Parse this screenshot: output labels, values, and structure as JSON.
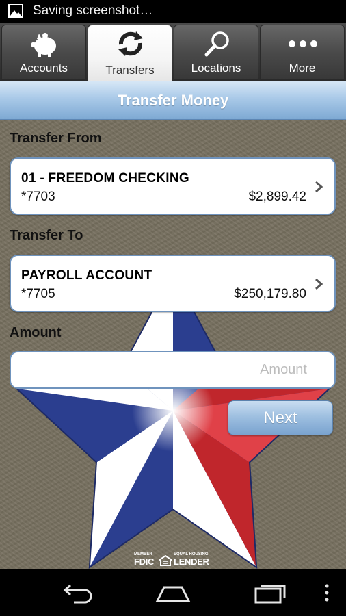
{
  "status_bar": {
    "notification_text": "Saving screenshot…",
    "icons": [
      "image-icon"
    ]
  },
  "tabs": [
    {
      "label": "Accounts",
      "icon": "piggy-bank-icon",
      "active": false
    },
    {
      "label": "Transfers",
      "icon": "transfer-arrows-icon",
      "active": true
    },
    {
      "label": "Locations",
      "icon": "magnifier-icon",
      "active": false
    },
    {
      "label": "More",
      "icon": "more-dots-icon",
      "active": false
    }
  ],
  "header": {
    "title": "Transfer Money"
  },
  "transfer_from": {
    "label": "Transfer From",
    "account": {
      "name": "01 - FREEDOM CHECKING",
      "number": "*7703",
      "balance": "$2,899.42"
    }
  },
  "transfer_to": {
    "label": "Transfer To",
    "account": {
      "name": "PAYROLL ACCOUNT",
      "number": "*7705",
      "balance": "$250,179.80"
    }
  },
  "amount": {
    "label": "Amount",
    "value": "",
    "placeholder": "Amount"
  },
  "next_button": {
    "label": "Next"
  },
  "footer": {
    "member_text": "MEMBER",
    "fdic_text": "FDIC",
    "equal_housing_text": "EQUAL HOUSING",
    "lender_text": "LENDER"
  },
  "colors": {
    "accent_blue": "#7ea9d3",
    "card_border": "#6f93bd",
    "star_red": "#c0262c",
    "star_blue": "#2b3e8f"
  },
  "nav_bar": {
    "buttons": [
      "back-icon",
      "home-icon",
      "recent-apps-icon",
      "menu-icon"
    ]
  }
}
